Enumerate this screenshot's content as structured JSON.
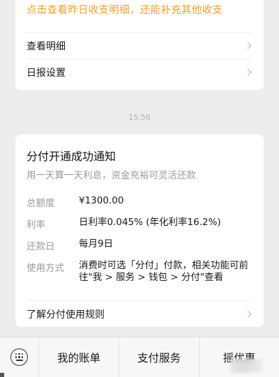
{
  "top_card": {
    "promo_text": "点击查看昨日收支明细，还能补充其他收支",
    "rows": [
      {
        "label": "查看明细"
      },
      {
        "label": "日报设置"
      }
    ]
  },
  "timestamp": "15:56",
  "notification": {
    "title": "分付开通成功通知",
    "subtitle": "用一天算一天利息，资金充裕可灵活还款",
    "fields": [
      {
        "key": "总额度",
        "value": "¥1300.00"
      },
      {
        "key": "利率",
        "value": "日利率0.045% (年化利率16.2%)"
      },
      {
        "key": "还款日",
        "value": "每月9日"
      },
      {
        "key": "使用方式",
        "value": "消费时可选「分付」付款，相关功能可前往\"我 > 服务 > 钱包 > 分付\"查看"
      }
    ],
    "footer_link": "了解分付使用规则"
  },
  "tabbar": {
    "keyboard_icon": "keyboard-icon",
    "tabs": [
      {
        "label": "我的账单"
      },
      {
        "label": "支付服务"
      },
      {
        "label": "摇优惠"
      }
    ]
  },
  "colors": {
    "background": "#ededed",
    "card": "#ffffff",
    "promo_orange": "#f0a030",
    "muted_text": "#9a9a9a"
  }
}
